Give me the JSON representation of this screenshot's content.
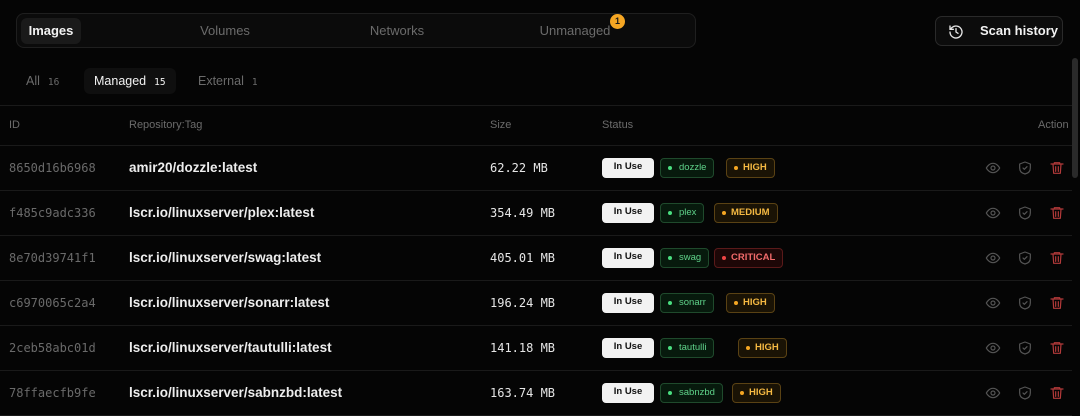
{
  "tabs": [
    {
      "label": "Images",
      "active": true
    },
    {
      "label": "Volumes",
      "active": false
    },
    {
      "label": "Networks",
      "active": false
    },
    {
      "label": "Unmanaged",
      "active": false,
      "badge": "1"
    }
  ],
  "scan_history": {
    "label": "Scan history",
    "icon": "history-icon"
  },
  "filters": [
    {
      "label": "All",
      "count": "16",
      "active": false
    },
    {
      "label": "Managed",
      "count": "15",
      "active": true
    },
    {
      "label": "External",
      "count": "1",
      "active": false
    }
  ],
  "table": {
    "headers": {
      "id": "ID",
      "repo": "Repository:Tag",
      "size": "Size",
      "status": "Status",
      "action": "Action"
    },
    "rows": [
      {
        "id": "8650d16b6968",
        "repo": "amir20/dozzle:latest",
        "size": "62.22 MB",
        "status": "In Use",
        "container": "dozzle",
        "severity": "HIGH",
        "severity_level": "high"
      },
      {
        "id": "f485c9adc336",
        "repo": "lscr.io/linuxserver/plex:latest",
        "size": "354.49 MB",
        "status": "In Use",
        "container": "plex",
        "severity": "MEDIUM",
        "severity_level": "medium"
      },
      {
        "id": "8e70d39741f1",
        "repo": "lscr.io/linuxserver/swag:latest",
        "size": "405.01 MB",
        "status": "In Use",
        "container": "swag",
        "severity": "CRITICAL",
        "severity_level": "critical"
      },
      {
        "id": "c6970065c2a4",
        "repo": "lscr.io/linuxserver/sonarr:latest",
        "size": "196.24 MB",
        "status": "In Use",
        "container": "sonarr",
        "severity": "HIGH",
        "severity_level": "high"
      },
      {
        "id": "2ceb58abc01d",
        "repo": "lscr.io/linuxserver/tautulli:latest",
        "size": "141.18 MB",
        "status": "In Use",
        "container": "tautulli",
        "severity": "HIGH",
        "severity_level": "high"
      },
      {
        "id": "78ffaecfb9fe",
        "repo": "lscr.io/linuxserver/sabnzbd:latest",
        "size": "163.74 MB",
        "status": "In Use",
        "container": "sabnzbd",
        "severity": "HIGH",
        "severity_level": "high"
      }
    ]
  },
  "actions": {
    "view": "eye-icon",
    "scan": "shield-check-icon",
    "delete": "trash-icon"
  },
  "colors": {
    "accent_badge": "#f5a623",
    "container_green": "#5fd38a",
    "severity_high": "#f5b942",
    "severity_critical": "#f26b6b",
    "delete_red": "#b33a3a"
  }
}
